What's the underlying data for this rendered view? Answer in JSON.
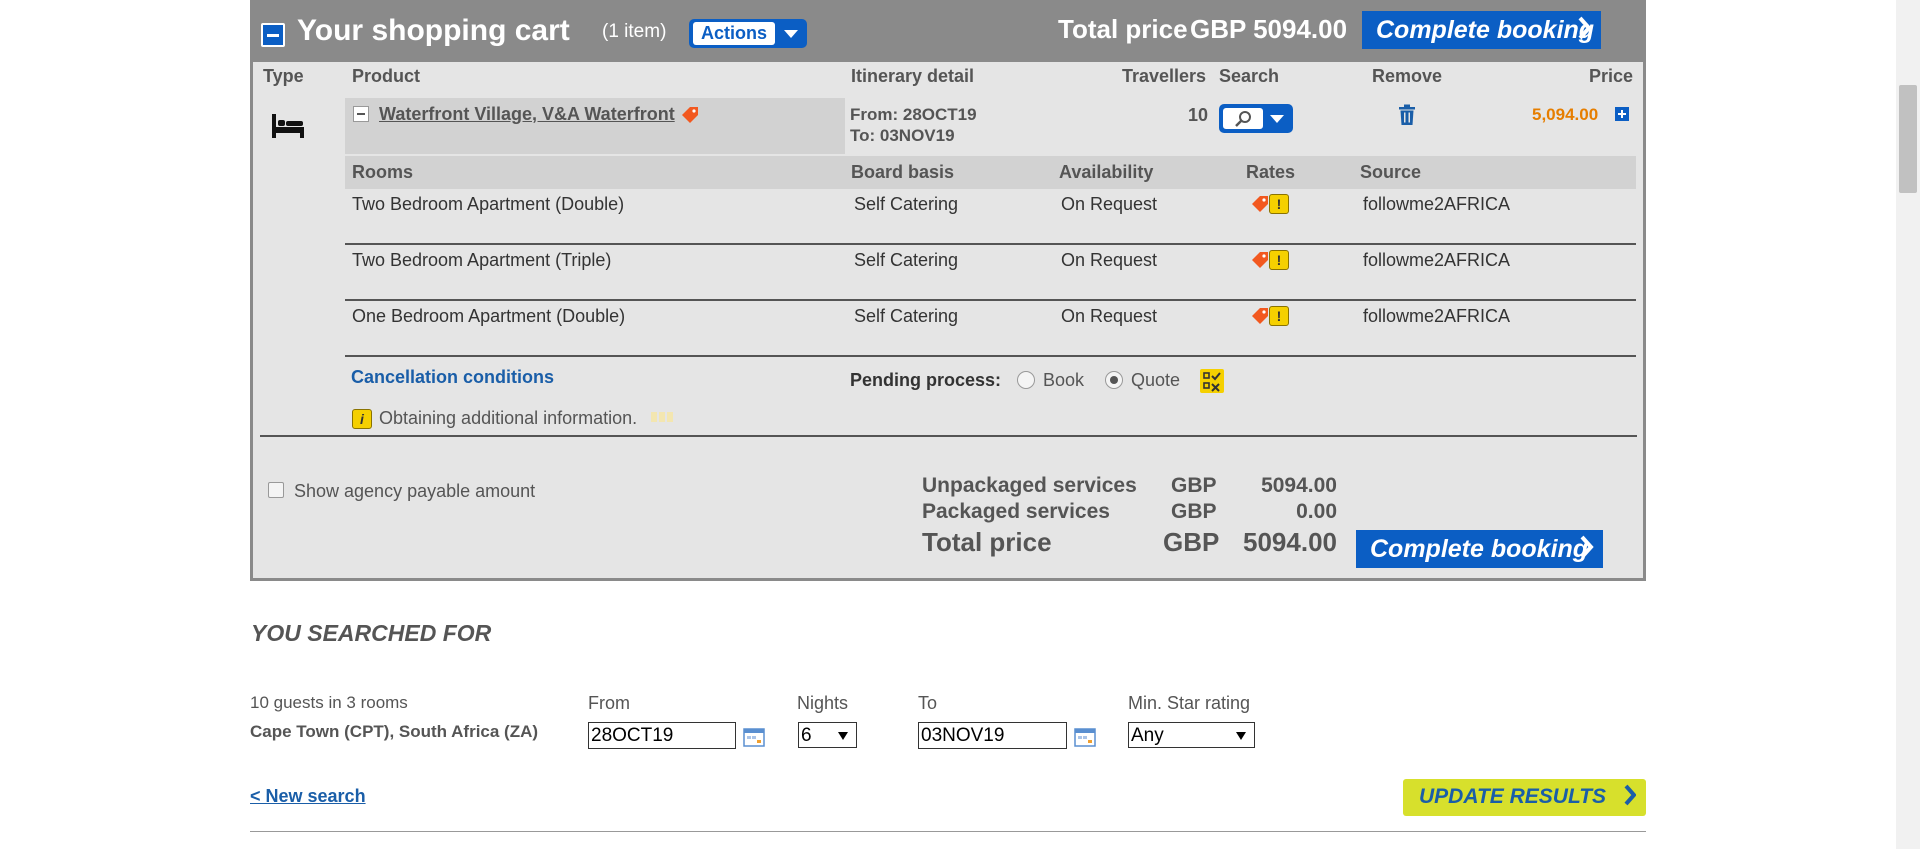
{
  "cart": {
    "title": "Your shopping cart",
    "count": "(1 item)",
    "actions_label": "Actions",
    "header_total_label": "Total price",
    "header_total_value": "GBP 5094.00",
    "complete_booking_label": "Complete booking",
    "columns": {
      "type": "Type",
      "product": "Product",
      "itinerary": "Itinerary detail",
      "travellers": "Travellers",
      "search": "Search",
      "remove": "Remove",
      "price": "Price"
    },
    "item": {
      "product_name": "Waterfront Village, V&A Waterfront",
      "from": "From: 28OCT19",
      "to": "To: 03NOV19",
      "travellers": "10",
      "price": "5,094.00"
    },
    "rooms_columns": {
      "rooms": "Rooms",
      "board_basis": "Board basis",
      "availability": "Availability",
      "rates": "Rates",
      "source": "Source"
    },
    "rooms": [
      {
        "name": "Two Bedroom Apartment (Double)",
        "board": "Self Catering",
        "availability": "On Request",
        "rate_warning": "!",
        "source": "followme2AFRICA"
      },
      {
        "name": "Two Bedroom Apartment (Triple)",
        "board": "Self Catering",
        "availability": "On Request",
        "rate_warning": "!",
        "source": "followme2AFRICA"
      },
      {
        "name": "One Bedroom Apartment (Double)",
        "board": "Self Catering",
        "availability": "On Request",
        "rate_warning": "!",
        "source": "followme2AFRICA"
      }
    ],
    "cancellation_link": "Cancellation conditions",
    "pending_label": "Pending process:",
    "pending_options": [
      "Book",
      "Quote"
    ],
    "pending_selected": "Quote",
    "info_glyph": "i",
    "info_text": "Obtaining additional information.",
    "agency_label": "Show agency payable amount",
    "summary": {
      "unpackaged_label": "Unpackaged services",
      "unpackaged_currency": "GBP",
      "unpackaged_value": "5094.00",
      "packaged_label": "Packaged services",
      "packaged_currency": "GBP",
      "packaged_value": "0.00",
      "total_label": "Total price",
      "total_currency": "GBP",
      "total_value": "5094.00"
    }
  },
  "search": {
    "title": "YOU SEARCHED FOR",
    "guests": "10 guests in 3 rooms",
    "location": "Cape Town (CPT), South Africa (ZA)",
    "from_label": "From",
    "from_value": "28OCT19",
    "nights_label": "Nights",
    "nights_value": "6",
    "to_label": "To",
    "to_value": "03NOV19",
    "star_label": "Min. Star rating",
    "star_value": "Any",
    "new_search": "< New search",
    "update_label": "UPDATE RESULTS"
  },
  "colors": {
    "header_gray": "#8a8a8a",
    "brand_blue": "#0b5ec4",
    "price_orange": "#e67e00",
    "update_green": "#d7e02c",
    "warning_yellow": "#f5d000"
  },
  "icons": {
    "collapse": "minus-square-icon",
    "bed": "bed-icon",
    "tag": "price-tag-icon",
    "search": "magnifier-icon",
    "remove": "trash-icon",
    "expand": "plus-square-icon",
    "calendar": "calendar-icon",
    "chevron": "chevron-right-icon",
    "info": "info-icon",
    "checklist": "checklist-icon"
  }
}
